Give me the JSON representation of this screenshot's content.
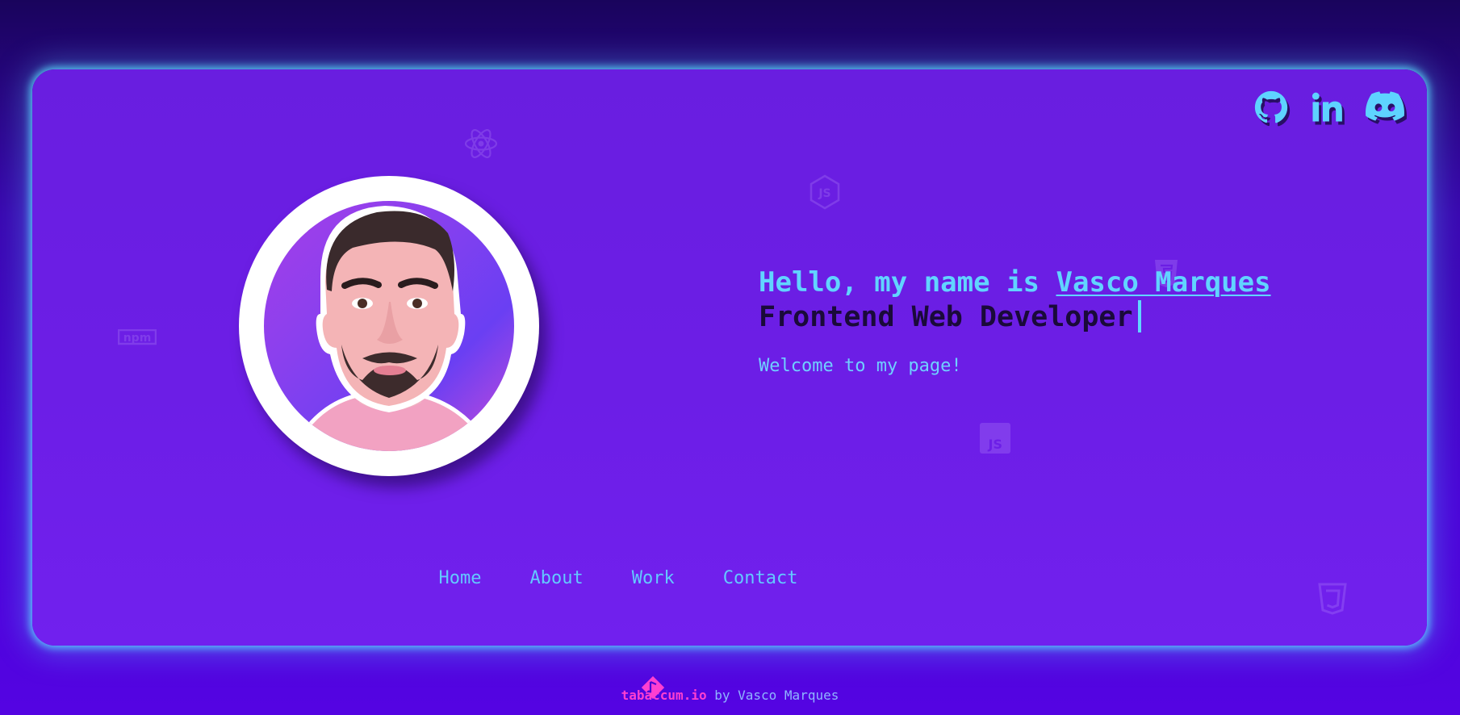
{
  "social": [
    {
      "name": "github-icon",
      "label": "GitHub"
    },
    {
      "name": "linkedin-icon",
      "label": "LinkedIn"
    },
    {
      "name": "discord-icon",
      "label": "Discord"
    }
  ],
  "hero": {
    "greeting_prefix": "Hello, my name is ",
    "name": "Vasco Marques",
    "role": "Frontend Web Developer",
    "welcome": "Welcome to my page!"
  },
  "avatar": {
    "alt": "Vasco Marques"
  },
  "nav": {
    "home": "Home",
    "about": "About",
    "work": "Work",
    "contact": "Contact"
  },
  "footer": {
    "brand": "tabaccum.io",
    "suffix": " by Vasco Marques"
  },
  "colors": {
    "accent": "#61d4ff",
    "card": "#6c1ee6",
    "brand": "#ff3fd0"
  },
  "background_icons": [
    "react-icon",
    "nodejs-icon",
    "html5-icon",
    "npm-icon",
    "javascript-icon",
    "css3-icon"
  ]
}
